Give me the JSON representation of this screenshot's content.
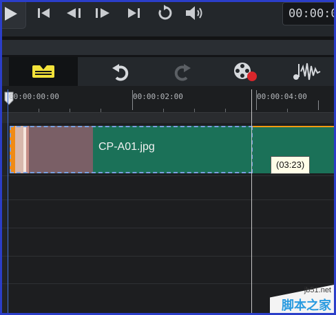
{
  "transport": {
    "timecode": "00:00:0",
    "buttons": [
      {
        "name": "play"
      },
      {
        "name": "go-to-start"
      },
      {
        "name": "previous-frame"
      },
      {
        "name": "next-frame"
      },
      {
        "name": "go-to-end"
      },
      {
        "name": "repeat"
      },
      {
        "name": "volume"
      }
    ]
  },
  "toolbar": {
    "tools": [
      {
        "name": "storyboard-timeline-toggle",
        "active": true
      },
      {
        "name": "undo"
      },
      {
        "name": "redo",
        "disabled": true
      },
      {
        "name": "record-capture"
      },
      {
        "name": "audio-mixer"
      }
    ]
  },
  "ruler": {
    "labels": [
      "00:00:00:00",
      "00:00:02:00",
      "00:00:04:00"
    ]
  },
  "timeline": {
    "clip_name": "CP-A01.jpg",
    "tooltip": "(03:23)"
  },
  "watermark": {
    "url": "jb51.net",
    "site": "脚本之家"
  },
  "colors": {
    "frame": "#2b3ec9",
    "clip": "#1b7158",
    "clip_edge": "#f08b16",
    "active_tool": "#f2e23a"
  }
}
